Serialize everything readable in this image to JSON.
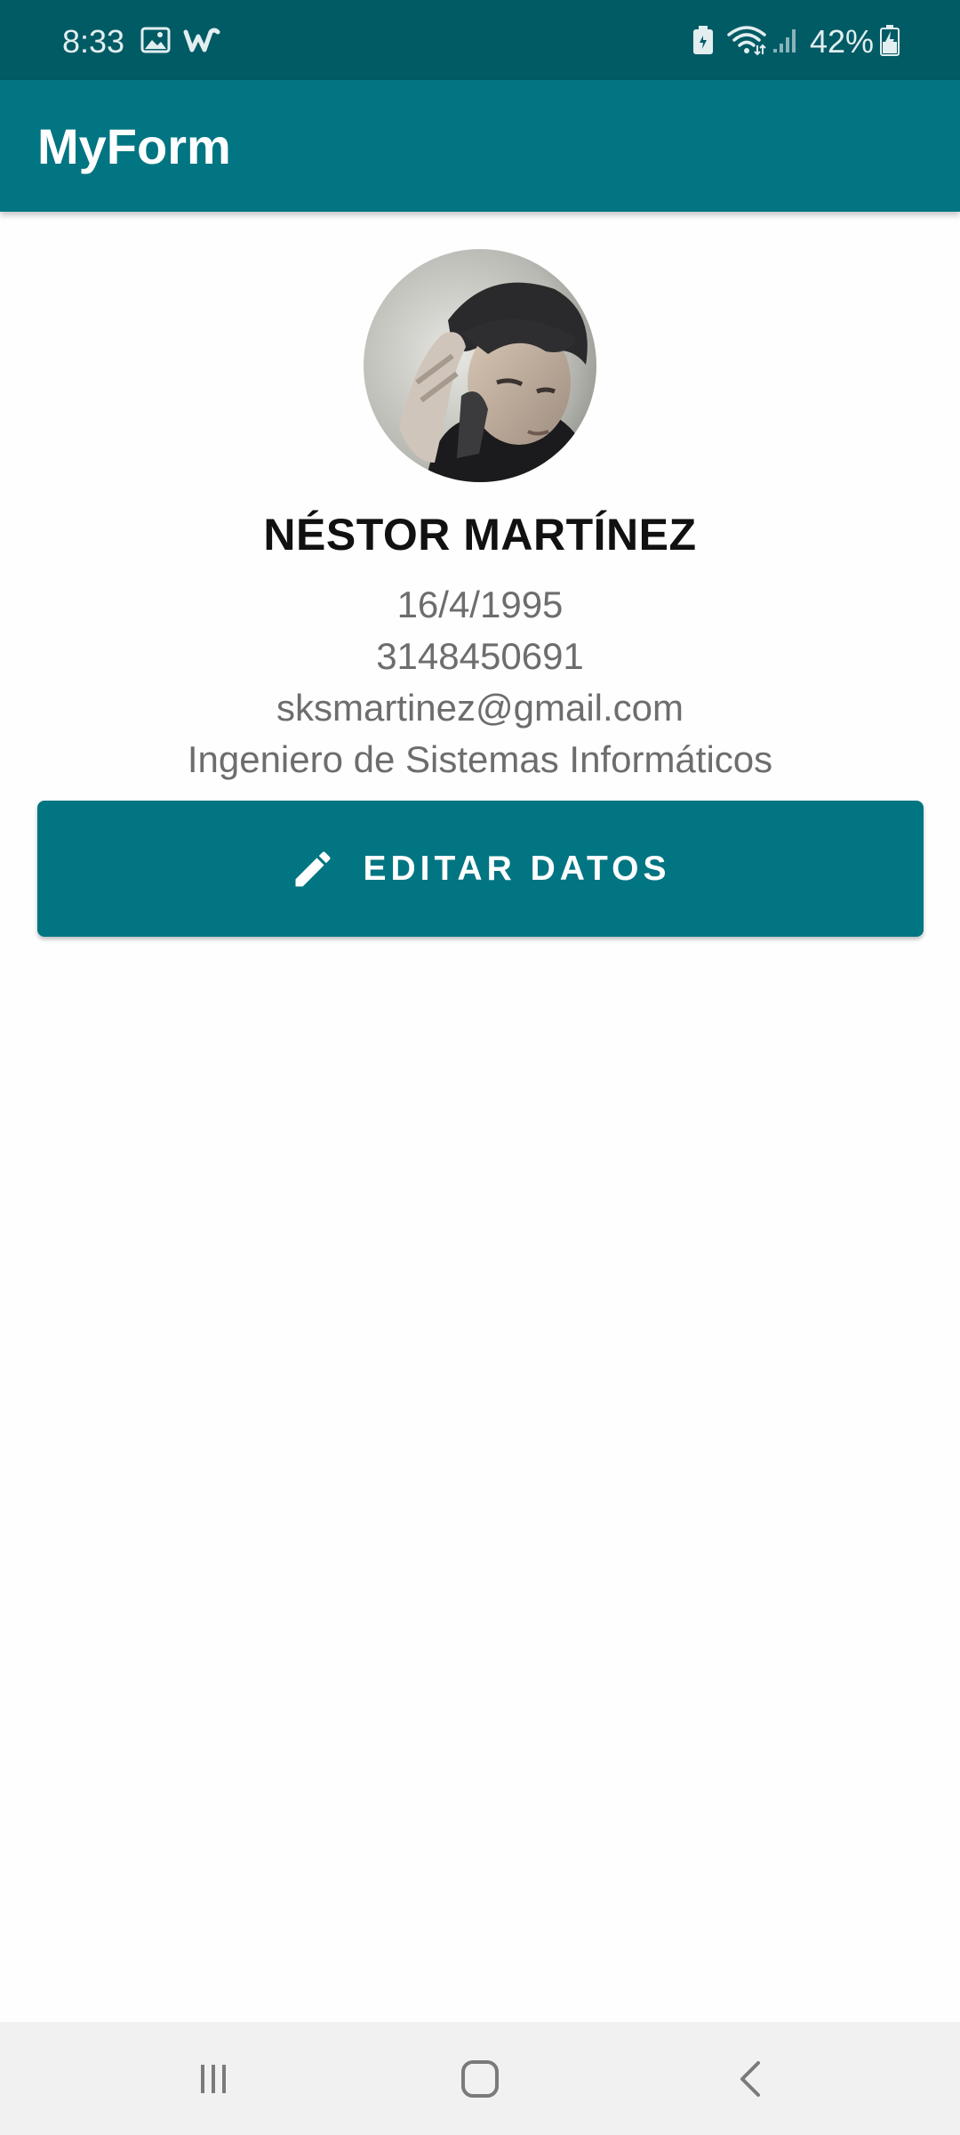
{
  "status_bar": {
    "time": "8:33",
    "battery_percent": "42%",
    "icons": [
      "gallery-icon",
      "wattpad-icon",
      "battery-saver-icon",
      "wifi-icon",
      "signal-icon",
      "battery-charging-icon"
    ]
  },
  "app_bar": {
    "title": "MyForm"
  },
  "profile": {
    "name": "NÉSTOR MARTÍNEZ",
    "birthdate": "16/4/1995",
    "phone": "3148450691",
    "email": "sksmartinez@gmail.com",
    "profession": "Ingeniero de Sistemas Informáticos"
  },
  "edit_button": {
    "label": "EDITAR DATOS",
    "icon": "pencil-icon"
  },
  "nav_bar": {
    "buttons": [
      "recent-apps-icon",
      "home-icon",
      "back-icon"
    ]
  },
  "colors": {
    "status_bar": "#005b65",
    "primary": "#017582",
    "background": "#fefefe",
    "nav_bar": "#f1f1f1",
    "name_text": "#111111",
    "info_text": "#6d6d6d"
  }
}
